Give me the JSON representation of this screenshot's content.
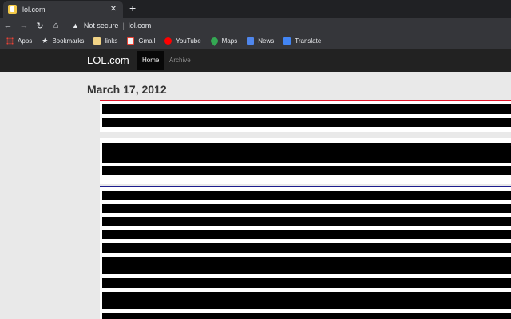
{
  "browser": {
    "tab": {
      "title": "lol.com",
      "close": "✕"
    },
    "new_tab": "+",
    "nav": {
      "back": "←",
      "forward": "→",
      "reload": "↻",
      "home": "⌂"
    },
    "omnibox": {
      "warning_icon": "▲",
      "security_label": "Not secure",
      "separator": "|",
      "url": "lol.com"
    },
    "bookmarks": [
      {
        "label": "Apps",
        "icon": "apps-icon"
      },
      {
        "label": "Bookmarks",
        "icon": "star-icon"
      },
      {
        "label": "links",
        "icon": "folder-icon"
      },
      {
        "label": "Gmail",
        "icon": "gmail-icon"
      },
      {
        "label": "YouTube",
        "icon": "youtube-icon"
      },
      {
        "label": "Maps",
        "icon": "maps-icon"
      },
      {
        "label": "News",
        "icon": "news-icon"
      },
      {
        "label": "Translate",
        "icon": "translate-icon"
      }
    ]
  },
  "site": {
    "brand": "LOL.com",
    "nav": {
      "home": "Home",
      "archive": "Archive"
    }
  },
  "content": {
    "date_heading": "March 17, 2012"
  },
  "colors": {
    "chrome_dark": "#202124",
    "chrome_bar": "#35363a",
    "header_bg": "#222222",
    "rule_red": "#e0162b",
    "rule_blue": "#1e1e8f",
    "page_bg": "#e9e9e9"
  }
}
